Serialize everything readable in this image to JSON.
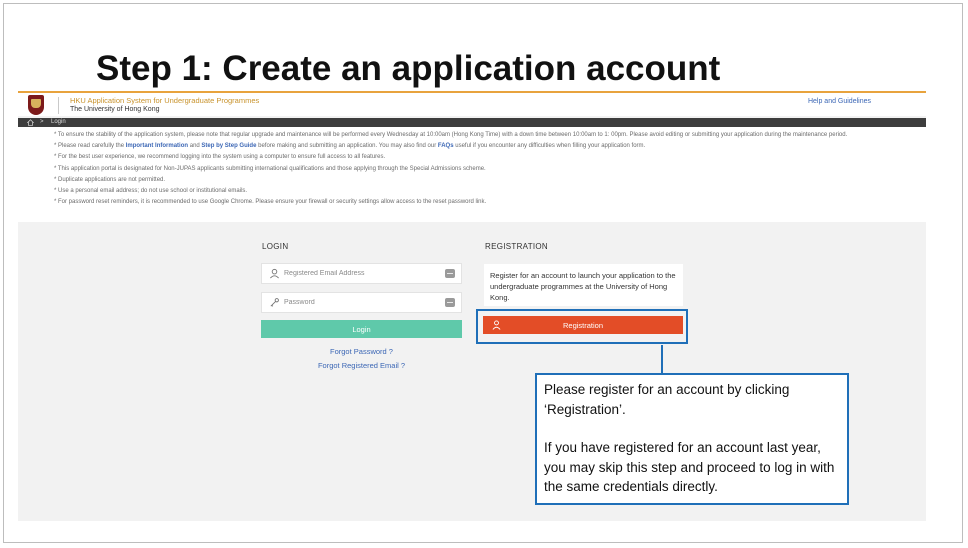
{
  "slide": {
    "title": "Step 1: Create an application account"
  },
  "header": {
    "app_name": "HKU Application System for Undergraduate Programmes",
    "org_name": "The University of Hong Kong",
    "help_link": "Help and Guidelines"
  },
  "breadcrumb": {
    "separator": ">",
    "current": "Login"
  },
  "notices": {
    "n1": "* To ensure the stability of the application system, please note that regular upgrade and maintenance will be performed every Wednesday at 10:00am (Hong Kong Time) with a down time between 10:00am to 1: 00pm. Please avoid editing or submitting your application during the maintenance period.",
    "n2_a": "* Please read carefully the ",
    "n2_link1": "Important Information",
    "n2_b": " and ",
    "n2_link2": "Step by Step Guide",
    "n2_c": " before making and submitting an application. You may also find our ",
    "n2_link3": "FAQs",
    "n2_d": " useful if you encounter any difficulties when filling your application form.",
    "n3": "* For the best user experience, we recommend logging into the system using a computer to ensure full access to all features.",
    "n4": "* This application portal is designated for Non-JUPAS applicants submitting international qualifications and those applying through the Special Admissions scheme.",
    "n5": "* Duplicate applications are not permitted.",
    "n6": "* Use a personal email address; do not use school or institutional emails.",
    "n7": "* For password reset reminders, it is recommended to use Google Chrome. Please ensure your firewall or security settings allow access to the reset password link."
  },
  "login": {
    "heading": "LOGIN",
    "email_placeholder": "Registered Email Address",
    "email_value": "",
    "password_placeholder": "Password",
    "password_value": "",
    "button_label": "Login",
    "forgot_password": "Forgot Password ?",
    "forgot_email": "Forgot Registered Email ?"
  },
  "registration": {
    "heading": "REGISTRATION",
    "description": "Register for an account to launch your application to the undergraduate programmes at the University of Hong Kong.",
    "button_label": "Registration"
  },
  "callout": {
    "line1": "Please register for an account by clicking ‘Registration’.",
    "line2": "If you have registered for an account last year, you may skip this step and proceed to log in with the same credentials directly."
  },
  "colors": {
    "accent": "#e8a33d",
    "login_button": "#5fc9aa",
    "registration_button": "#e34d27",
    "callout_border": "#1f6fb8",
    "link": "#3c67b5"
  },
  "icons": {
    "logo": "hku-crest-icon",
    "home": "home-icon",
    "user": "user-icon",
    "key": "key-icon",
    "field_end": "keyboard-icon"
  }
}
